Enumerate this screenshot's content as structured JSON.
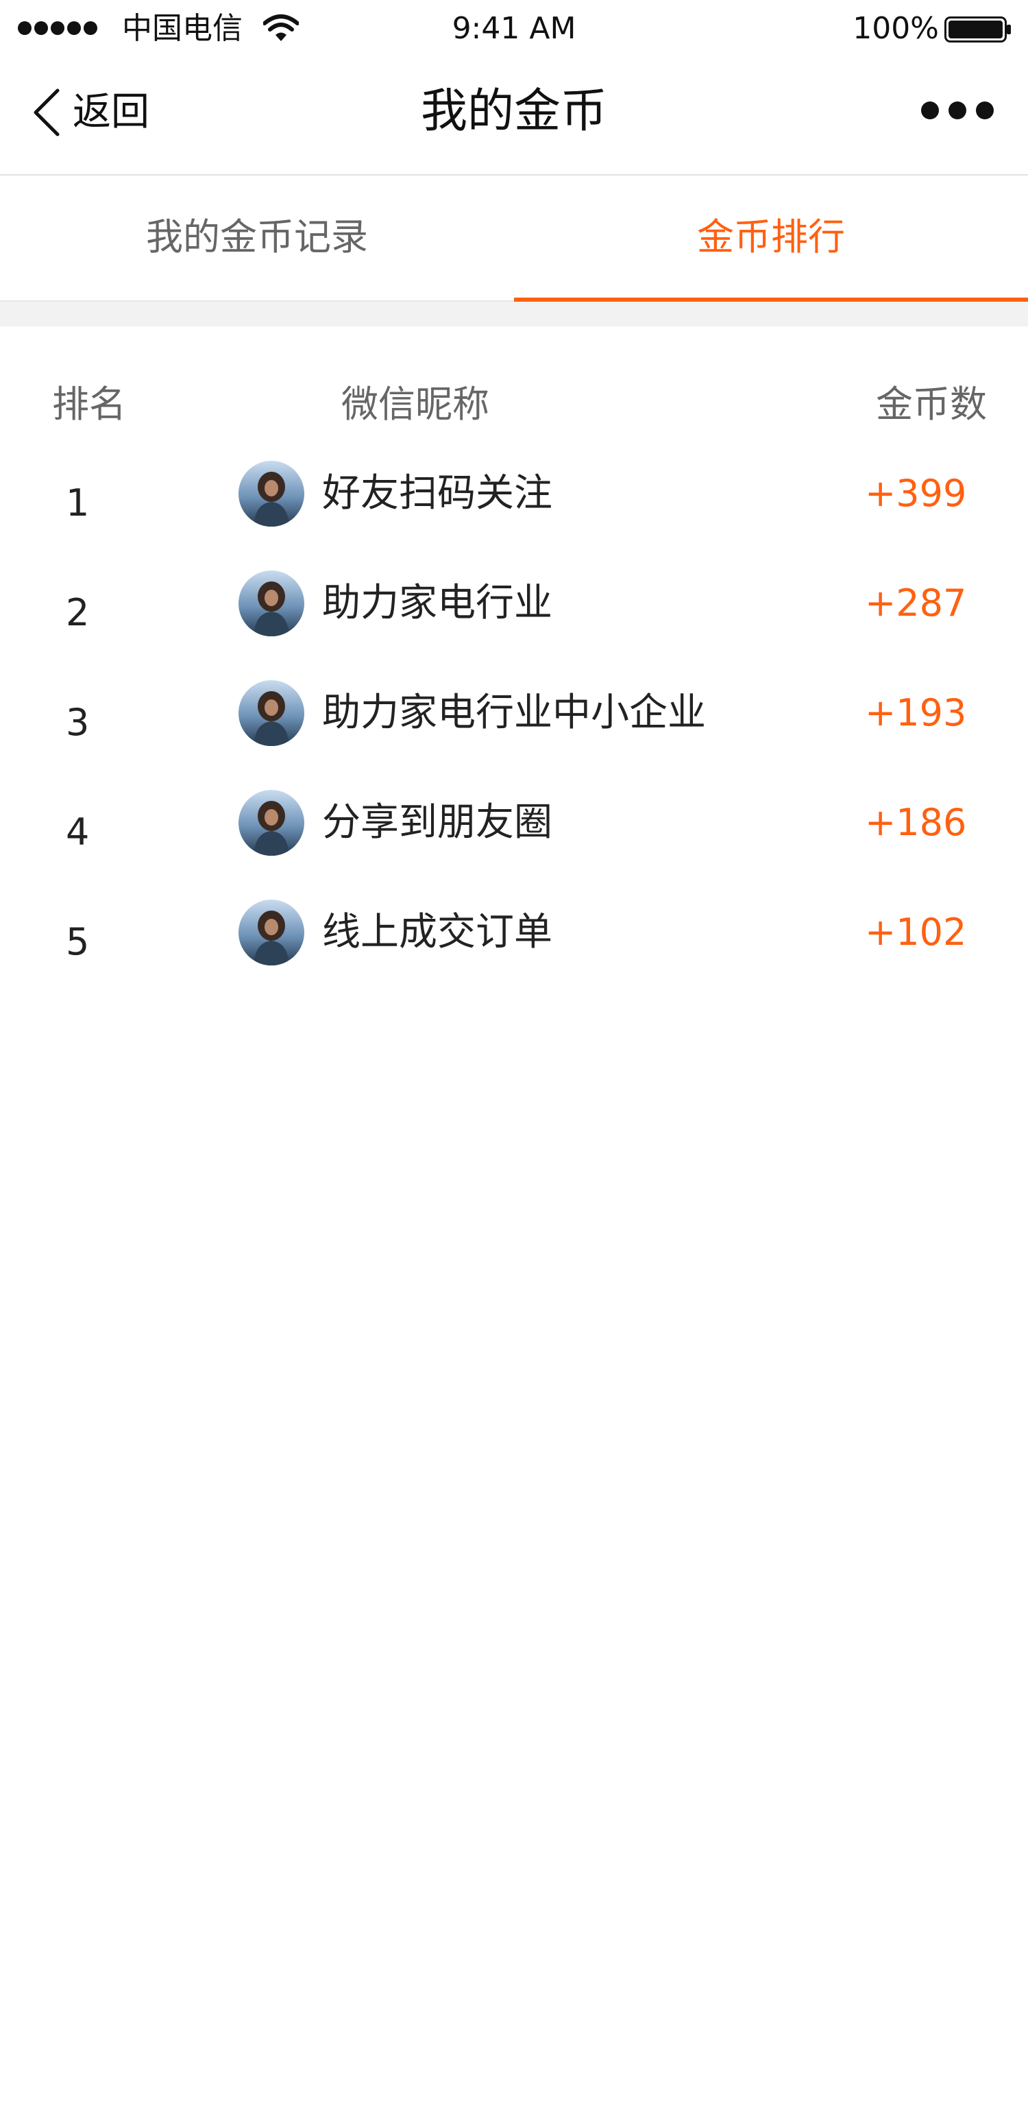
{
  "status_bar": {
    "carrier": "中国电信",
    "time": "9:41 AM",
    "battery": "100%"
  },
  "nav": {
    "back_label": "返回",
    "title": "我的金币"
  },
  "tabs": [
    {
      "label": "我的金币记录",
      "active": false
    },
    {
      "label": "金币排行",
      "active": true
    }
  ],
  "table": {
    "headers": {
      "rank": "排名",
      "nickname": "微信昵称",
      "coins": "金币数"
    },
    "rows": [
      {
        "rank": "1",
        "nickname": "好友扫码关注",
        "coins": "+399"
      },
      {
        "rank": "2",
        "nickname": "助力家电行业",
        "coins": "+287"
      },
      {
        "rank": "3",
        "nickname": "助力家电行业中小企业",
        "coins": "+193"
      },
      {
        "rank": "4",
        "nickname": "分享到朋友圈",
        "coins": "+186"
      },
      {
        "rank": "5",
        "nickname": "线上成交订单",
        "coins": "+102"
      }
    ]
  },
  "colors": {
    "accent": "#ff6011",
    "text": "#222222",
    "muted": "#666666",
    "divider": "#e6e6e6",
    "band": "#f2f2f2"
  }
}
